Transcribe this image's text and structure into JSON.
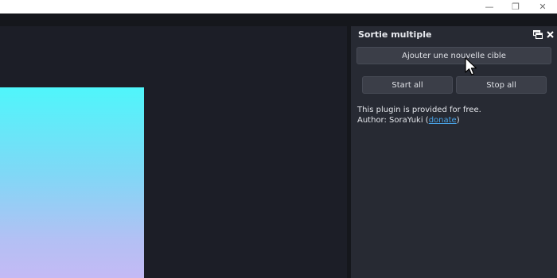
{
  "window_controls": {
    "minimize_glyph": "—",
    "restore_glyph": "❐",
    "close_glyph": "✕"
  },
  "preview": {
    "gradient_colors": [
      "#4ff6fb",
      "#7fd8f6",
      "#b3c0f4",
      "#c4baf5"
    ]
  },
  "dock": {
    "title": "Sortie multiple",
    "add_target_label": "Ajouter une nouvelle cible",
    "start_all_label": "Start all",
    "stop_all_label": "Stop all",
    "info_line1": "This plugin is provided for free.",
    "author_prefix": "Author: SoraYuki (",
    "donate_label": "donate",
    "author_suffix": ")"
  },
  "colors": {
    "background": "#1b1d24",
    "panel": "#272a33",
    "button": "#3b3e48",
    "link": "#4aa3e6"
  },
  "icons": [
    "minimize-icon",
    "restore-icon",
    "close-icon",
    "undock-icon",
    "dock-close-icon",
    "mouse-cursor-icon"
  ]
}
